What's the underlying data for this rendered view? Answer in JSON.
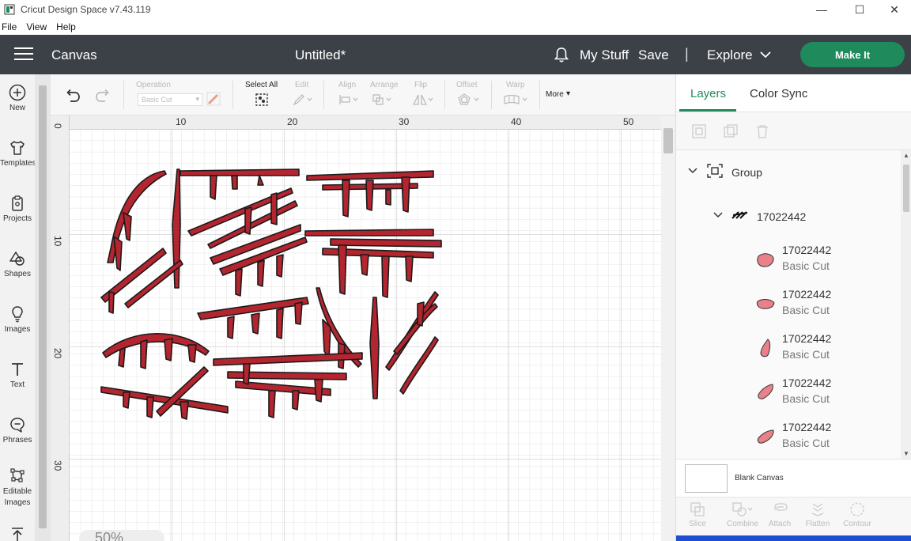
{
  "window": {
    "title": "Cricut Design Space  v7.43.119",
    "minimize": "—",
    "maximize": "☐",
    "close": "✕"
  },
  "menu": [
    "File",
    "View",
    "Help"
  ],
  "header": {
    "canvas_label": "Canvas",
    "doc_title": "Untitled*",
    "my_stuff": "My Stuff",
    "save": "Save",
    "separator": "|",
    "explore": "Explore",
    "make_it": "Make It",
    "accent_color": "#1f8a5b",
    "bar_color": "#3c4148"
  },
  "sidebar": {
    "items": [
      {
        "label": "New",
        "icon": "plus-circle-icon"
      },
      {
        "label": "Templates",
        "icon": "tshirt-icon"
      },
      {
        "label": "Projects",
        "icon": "clipboard-icon"
      },
      {
        "label": "Shapes",
        "icon": "shapes-icon"
      },
      {
        "label": "Images",
        "icon": "lightbulb-icon"
      },
      {
        "label": "Text",
        "icon": "text-icon"
      },
      {
        "label": "Phrases",
        "icon": "speech-bubble-icon"
      },
      {
        "label": "Editable Images",
        "icon": "editable-image-icon"
      },
      {
        "label": "",
        "icon": "upload-icon"
      }
    ]
  },
  "toolbar": {
    "operation_label": "Operation",
    "operation_value": "Basic Cut",
    "select_all": "Select All",
    "edit": "Edit",
    "align": "Align",
    "arrange": "Arrange",
    "flip": "Flip",
    "offset": "Offset",
    "warp": "Warp",
    "more": "More"
  },
  "canvas": {
    "ruler_top": [
      "0",
      "10",
      "20",
      "30",
      "40",
      "50"
    ],
    "ruler_left": [
      "0",
      "10",
      "20",
      "30"
    ],
    "zoom": "50%",
    "design_color": "#b3252f"
  },
  "layers_panel": {
    "tabs": [
      "Layers",
      "Color Sync"
    ],
    "group_label": "Group",
    "subgroup_label": "17022442",
    "layers": [
      {
        "name": "17022442",
        "operation": "Basic Cut"
      },
      {
        "name": "17022442",
        "operation": "Basic Cut"
      },
      {
        "name": "17022442",
        "operation": "Basic Cut"
      },
      {
        "name": "17022442",
        "operation": "Basic Cut"
      },
      {
        "name": "17022442",
        "operation": "Basic Cut"
      }
    ],
    "layer_swatch_color": "#e8818a",
    "blank_canvas": "Blank Canvas",
    "bottom_tools": [
      "Slice",
      "Combine",
      "Attach",
      "Flatten",
      "Contour"
    ]
  }
}
